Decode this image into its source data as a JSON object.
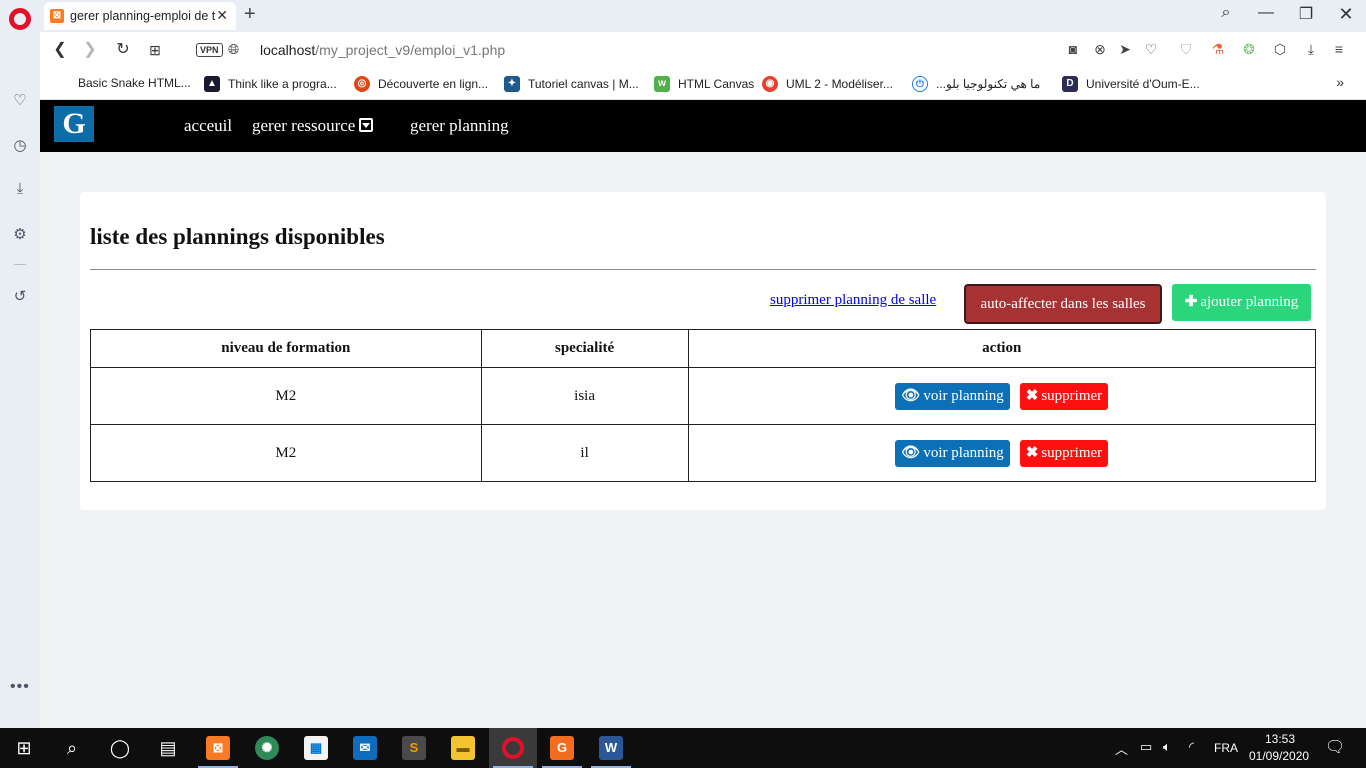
{
  "browser": {
    "tab": {
      "title": "gerer planning-emploi de t",
      "close": "✕"
    },
    "new_tab": "+",
    "window_controls": [
      "search-icon",
      "minimize-icon",
      "restore-icon",
      "close-icon"
    ],
    "address": {
      "vpn": "VPN",
      "host": "localhost",
      "path": "/my_project_v9/emploi_v1.php"
    },
    "bookmarks": [
      {
        "label": "Basic Snake HTML...",
        "icon": "none"
      },
      {
        "label": "Think like a progra...",
        "icon": "think-icon",
        "color": "#1a1a2e"
      },
      {
        "label": "Découverte en lign...",
        "icon": "ubuntu-icon",
        "color": "#dd4814"
      },
      {
        "label": "Tutoriel canvas | M...",
        "icon": "mdn-icon",
        "color": "#1d5a8e"
      },
      {
        "label": "HTML Canvas",
        "icon": "w3-icon",
        "color": "#52b04b"
      },
      {
        "label": "UML 2 - Modéliser...",
        "icon": "target-icon",
        "color": "#e8402e"
      },
      {
        "label": "ما هي تكنولوجيا بلو...",
        "icon": "power-icon",
        "color": "#1c7ed6"
      },
      {
        "label": "Université d'Oum-E...",
        "icon": "d-icon",
        "color": "#2c2c54"
      }
    ],
    "bookmarks_more": "»"
  },
  "navbar": {
    "brand": "G",
    "links": [
      "acceuil",
      "gerer ressource",
      "gerer planning"
    ]
  },
  "page": {
    "title": "liste des plannings disponibles",
    "delete_salle_link": "supprimer planning de salle",
    "auto_button": "auto-affecter dans les salles",
    "add_button": "ajouter planning",
    "table": {
      "headers": [
        "niveau de formation",
        "specialité",
        "action"
      ],
      "rows": [
        {
          "niveau": "M2",
          "specialite": "isia"
        },
        {
          "niveau": "M2",
          "specialite": "il"
        }
      ],
      "voir_label": "voir planning",
      "suppr_label": "supprimer"
    }
  },
  "taskbar": {
    "language": "FRA",
    "time": "13:53",
    "date": "01/09/2020"
  },
  "colors": {
    "navbar": "#000000",
    "brand": "#0d6da9",
    "auto_button": "#a73233",
    "add_button": "#2ad57c",
    "voir_button": "#0b70b5",
    "suppr_button": "#ff1010",
    "link": "#0000ee"
  }
}
